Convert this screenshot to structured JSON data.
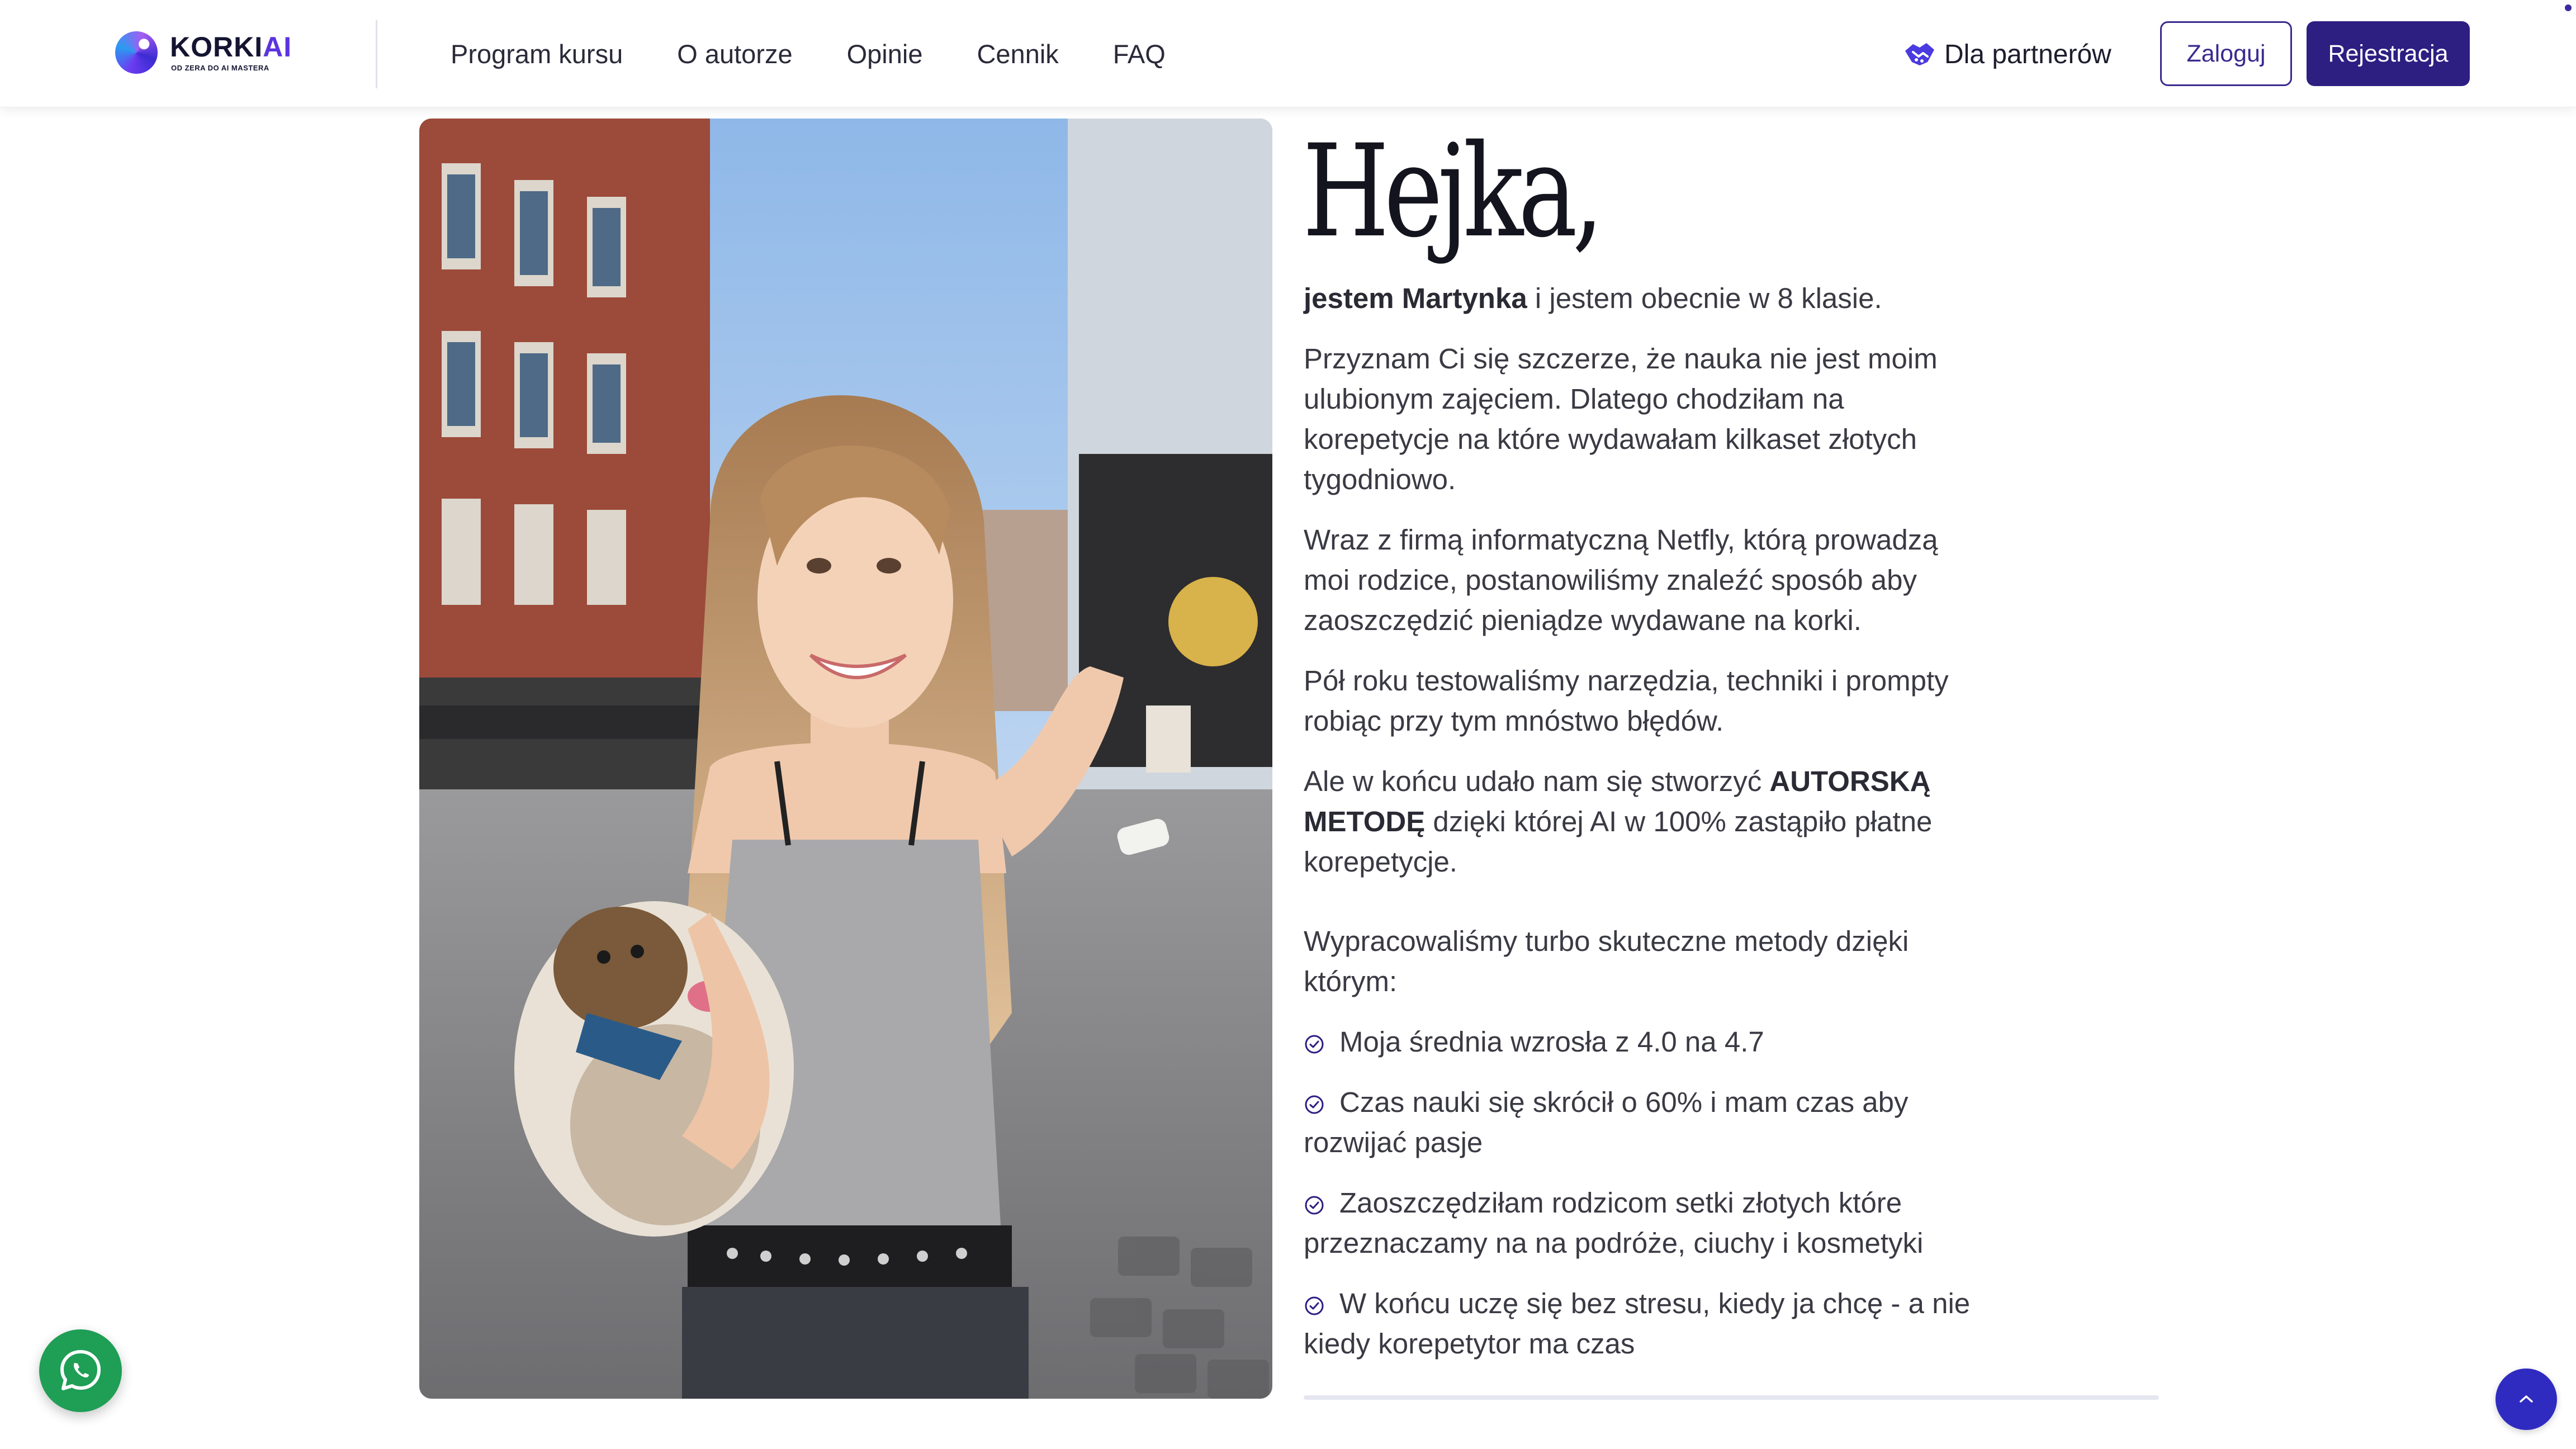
{
  "brand": {
    "name_main": "KORKI",
    "name_accent": "AI",
    "tagline": "OD ZERA DO AI MASTERA"
  },
  "nav": {
    "items": [
      {
        "label": "Program kursu"
      },
      {
        "label": "O autorze"
      },
      {
        "label": "Opinie"
      },
      {
        "label": "Cennik"
      },
      {
        "label": "FAQ"
      }
    ]
  },
  "header_actions": {
    "partners_label": "Dla partnerów",
    "partners_icon": "handshake-icon",
    "login_label": "Zaloguj",
    "register_label": "Rejestracja"
  },
  "about": {
    "greeting": "Hejka,",
    "intro_name": "jestem Martynka",
    "intro_rest": " i jestem obecnie w 8 klasie.",
    "paragraphs": [
      "Przyznam Ci się szczerze, że nauka nie jest moim ulubionym zajęciem. Dlatego chodziłam na korepetycje na które wydawałam kilkaset złotych tygodniowo.",
      "Wraz z firmą informatyczną Netfly, którą prowadzą moi rodzice, postanowiliśmy znaleźć sposób aby zaoszczędzić pieniądze wydawane na korki.",
      "Pół roku testowaliśmy narzędzia, techniki i prompty robiąc przy tym mnóstwo błędów."
    ],
    "method_before": "Ale w końcu udało nam się stworzyć ",
    "method_strong": "AUTORSKĄ METODĘ",
    "method_after": " dzięki której AI w 100% zastąpiło płatne korepetycje.",
    "list_intro": "Wypracowaliśmy turbo skuteczne metody dzięki którym:",
    "benefits": [
      "Moja średnia wzrosła z 4.0 na 4.7",
      "Czas nauki się skrócił o 60% i mam czas aby rozwijać pasje",
      "Zaoszczędziłam rodzicom setki złotych które przeznaczamy na na podróże, ciuchy i kosmetyki",
      "W końcu uczę się bez stresu, kiedy ja chcę - a nie kiedy korepetytor ma czas"
    ]
  },
  "floating": {
    "whatsapp_icon": "whatsapp-icon",
    "scroll_top_icon": "chevron-up-icon"
  },
  "colors": {
    "brand_dark": "#2d1e82",
    "brand_accent": "#5b34e0",
    "whatsapp": "#1f9e55",
    "scroll_top": "#2f2bc0"
  }
}
